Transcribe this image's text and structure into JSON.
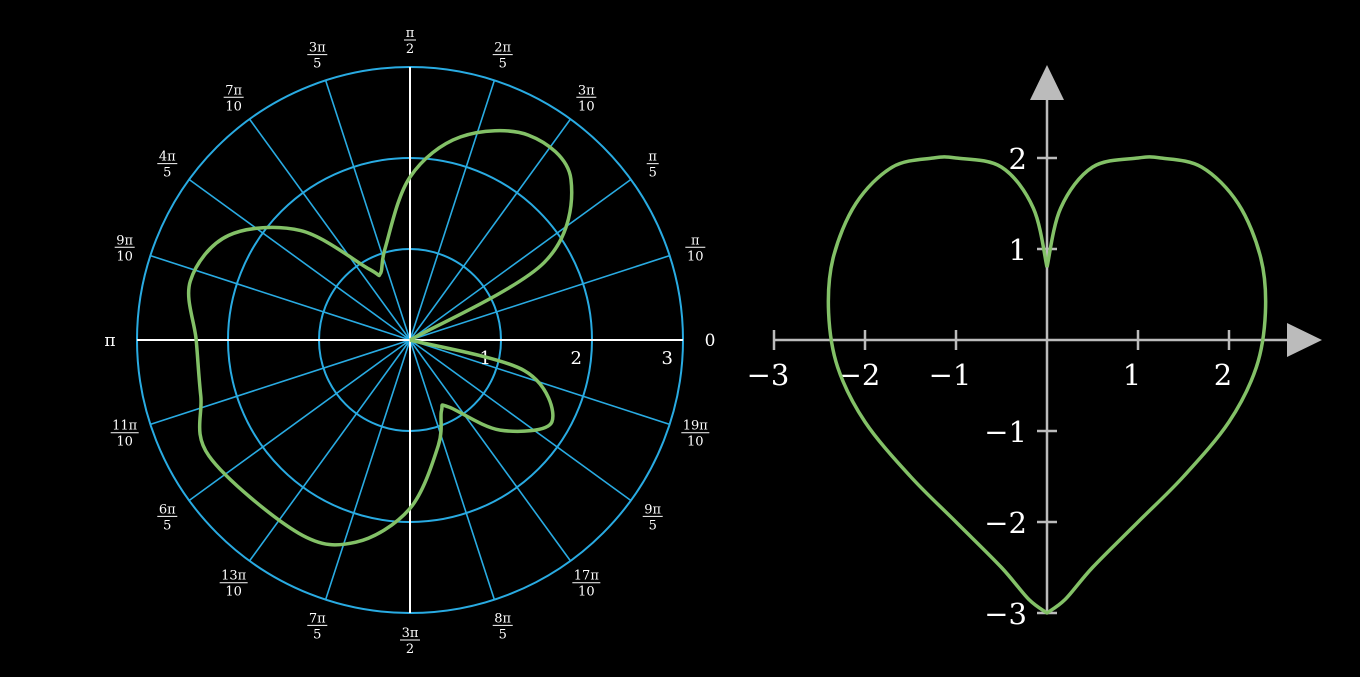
{
  "theme": {
    "background": "#000000",
    "polar_grid": "#29abe2",
    "axis_white": "#ffffff",
    "axis_grey": "#bbbbbb",
    "curve": "#83c167"
  },
  "chart_data": [
    {
      "type": "line",
      "coordinate_system": "polar",
      "title": "",
      "radius_range": [
        0,
        3
      ],
      "radius_ticks": [
        "1",
        "2",
        "3"
      ],
      "angle_ticks": [
        {
          "label": "0",
          "num": "",
          "den": ""
        },
        {
          "label": "",
          "num": "π",
          "den": "10"
        },
        {
          "label": "",
          "num": "π",
          "den": "5"
        },
        {
          "label": "",
          "num": "3π",
          "den": "10"
        },
        {
          "label": "",
          "num": "2π",
          "den": "5"
        },
        {
          "label": "",
          "num": "π",
          "den": "2"
        },
        {
          "label": "",
          "num": "3π",
          "den": "5"
        },
        {
          "label": "",
          "num": "7π",
          "den": "10"
        },
        {
          "label": "",
          "num": "4π",
          "den": "5"
        },
        {
          "label": "",
          "num": "9π",
          "den": "10"
        },
        {
          "label": "π",
          "num": "",
          "den": ""
        },
        {
          "label": "",
          "num": "11π",
          "den": "10"
        },
        {
          "label": "",
          "num": "6π",
          "den": "5"
        },
        {
          "label": "",
          "num": "13π",
          "den": "10"
        },
        {
          "label": "",
          "num": "7π",
          "den": "5"
        },
        {
          "label": "",
          "num": "3π",
          "den": "2"
        },
        {
          "label": "",
          "num": "8π",
          "den": "5"
        },
        {
          "label": "",
          "num": "17π",
          "den": "10"
        },
        {
          "label": "",
          "num": "9π",
          "den": "5"
        },
        {
          "label": "",
          "num": "19π",
          "den": "10"
        }
      ],
      "grid": true,
      "series": [
        {
          "curve": "two-lobed polar curve through the pole",
          "points": [
            {
              "theta_deg": 0,
              "r": 0.0
            },
            {
              "theta_deg": 30,
              "r": 1.7
            },
            {
              "theta_deg": 45,
              "r": 2.5
            },
            {
              "theta_deg": 60,
              "r": 2.6
            },
            {
              "theta_deg": 76,
              "r": 2.3
            },
            {
              "theta_deg": 90,
              "r": 1.79
            },
            {
              "theta_deg": 105,
              "r": 1.05
            },
            {
              "theta_deg": 114,
              "r": 0.8
            },
            {
              "theta_deg": 120,
              "r": 0.9
            },
            {
              "theta_deg": 135,
              "r": 1.7
            },
            {
              "theta_deg": 150,
              "r": 2.3
            },
            {
              "theta_deg": 165,
              "r": 2.5
            },
            {
              "theta_deg": 180,
              "r": 2.35
            },
            {
              "theta_deg": 195,
              "r": 2.38
            },
            {
              "theta_deg": 210,
              "r": 2.55
            },
            {
              "theta_deg": 240,
              "r": 2.45
            },
            {
              "theta_deg": 255,
              "r": 2.3
            },
            {
              "theta_deg": 270,
              "r": 1.85
            },
            {
              "theta_deg": 285,
              "r": 1.2
            },
            {
              "theta_deg": 294,
              "r": 0.85
            },
            {
              "theta_deg": 300,
              "r": 0.85
            },
            {
              "theta_deg": 315,
              "r": 1.4
            },
            {
              "theta_deg": 330,
              "r": 1.8
            },
            {
              "theta_deg": 345,
              "r": 1.3
            },
            {
              "theta_deg": 360,
              "r": 0.0
            }
          ]
        }
      ]
    },
    {
      "type": "line",
      "coordinate_system": "cartesian",
      "title": "",
      "xlabel": "",
      "ylabel": "",
      "xlim": [
        -3,
        3
      ],
      "ylim": [
        -3,
        2.8
      ],
      "x_ticks": [
        "−3",
        "−2",
        "−1",
        "1",
        "2"
      ],
      "y_ticks": [
        "2",
        "1",
        "−1",
        "−2",
        "−3"
      ],
      "grid": false,
      "series": [
        {
          "curve": "heart curve",
          "points": [
            [
              0.0,
              0.8
            ],
            [
              0.15,
              1.45
            ],
            [
              0.5,
              1.9
            ],
            [
              1.0,
              2.0
            ],
            [
              1.25,
              2.0
            ],
            [
              1.7,
              1.9
            ],
            [
              2.1,
              1.5
            ],
            [
              2.35,
              0.9
            ],
            [
              2.4,
              0.3
            ],
            [
              2.3,
              -0.3
            ],
            [
              2.0,
              -0.9
            ],
            [
              1.5,
              -1.5
            ],
            [
              1.0,
              -2.0
            ],
            [
              0.5,
              -2.5
            ],
            [
              0.2,
              -2.85
            ],
            [
              0.0,
              -3.0
            ],
            [
              -0.2,
              -2.85
            ],
            [
              -0.5,
              -2.5
            ],
            [
              -1.0,
              -2.0
            ],
            [
              -1.5,
              -1.5
            ],
            [
              -2.0,
              -0.9
            ],
            [
              -2.3,
              -0.3
            ],
            [
              -2.4,
              0.3
            ],
            [
              -2.35,
              0.9
            ],
            [
              -2.1,
              1.5
            ],
            [
              -1.7,
              1.9
            ],
            [
              -1.25,
              2.0
            ],
            [
              -1.0,
              2.0
            ],
            [
              -0.5,
              1.9
            ],
            [
              -0.15,
              1.45
            ],
            [
              0.0,
              0.8
            ]
          ]
        }
      ]
    }
  ]
}
